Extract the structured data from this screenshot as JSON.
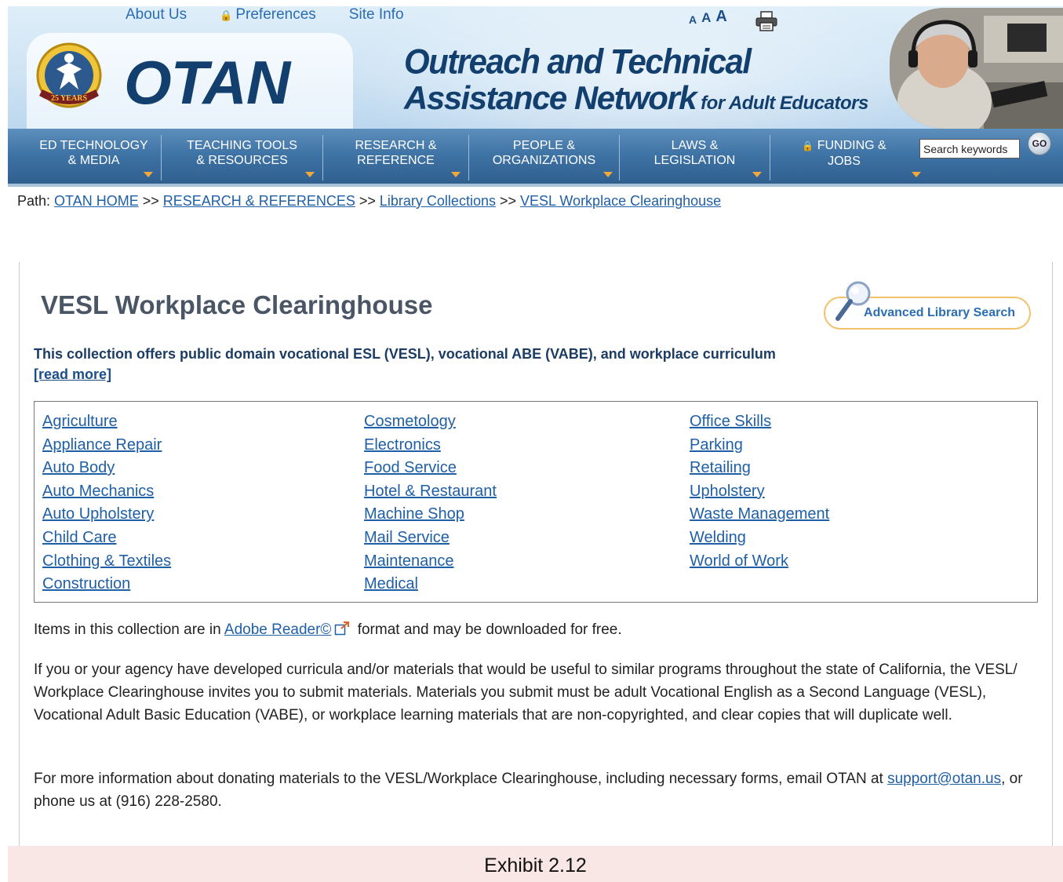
{
  "header": {
    "top_links": {
      "about": "About Us",
      "preferences": "Preferences",
      "site_info": "Site Info"
    },
    "font_sizes": [
      "A",
      "A",
      "A"
    ],
    "logo_text": "OTAN",
    "badge_text": "25 YEARS",
    "tagline_line1": "Outreach and Technical",
    "tagline_line2": "Assistance Network",
    "tagline_line3": "for Adult Educators"
  },
  "nav": {
    "items": [
      {
        "line1": "ED TECHNOLOGY",
        "line2": "& MEDIA"
      },
      {
        "line1": "TEACHING TOOLS",
        "line2": "& RESOURCES"
      },
      {
        "line1": "RESEARCH &",
        "line2": "REFERENCE"
      },
      {
        "line1": "PEOPLE &",
        "line2": "ORGANIZATIONS"
      },
      {
        "line1": "LAWS &",
        "line2": "LEGISLATION"
      },
      {
        "line1": "FUNDING &",
        "line2": "JOBS"
      }
    ],
    "search_placeholder": "Search keywords",
    "go_label": "GO"
  },
  "breadcrumb": {
    "prefix": "Path:",
    "items": [
      "OTAN HOME",
      "RESEARCH & REFERENCES",
      "Library Collections",
      "VESL Workplace Clearinghouse"
    ],
    "separator": ">>"
  },
  "main": {
    "title": "VESL Workplace Clearinghouse",
    "advanced_search_label": "Advanced Library Search",
    "summary": "This collection offers public domain vocational ESL (VESL), vocational ABE (VABE), and workplace curriculum",
    "read_more": "[read more]",
    "categories": {
      "col1": [
        "Agriculture",
        "Appliance Repair",
        "Auto Body",
        "Auto Mechanics",
        "Auto Upholstery",
        "Child Care",
        "Clothing & Textiles",
        "Construction"
      ],
      "col2": [
        "Cosmetology",
        "Electronics",
        "Food Service",
        "Hotel & Restaurant",
        "Machine Shop",
        "Mail Service",
        "Maintenance",
        "Medical"
      ],
      "col3": [
        "Office Skills",
        "Parking",
        "Retailing",
        "Upholstery",
        "Waste Management",
        "Welding",
        "World of Work"
      ]
    },
    "para1_before": "Items in this collection are in ",
    "para1_link": "Adobe Reader©",
    "para1_after": " format and may be downloaded for free.",
    "para2": "If you or your agency have developed curricula and/or materials that would be useful to similar programs throughout the state of California, the VESL/ Workplace Clearinghouse invites you to submit materials. Materials you submit must be adult Vocational English as a Second Language (VESL), Vocational Adult Basic Education (VABE), or workplace learning materials that are non-copyrighted, and clear copies that will duplicate well.",
    "para3_before": "For more information about donating materials to the VESL/Workplace Clearinghouse, including necessary forms, email OTAN at ",
    "para3_link": "support@otan.us",
    "para3_after": ", or phone us at (916) 228-2580."
  },
  "caption": "Exhibit 2.12",
  "colors": {
    "nav_bg": "#3f74a6",
    "logo_navy": "#123f6e",
    "link_blue": "#1f5fa6",
    "accent_orange": "#f2a83b",
    "caption_bg": "#f8e7e4"
  },
  "icons": [
    "lock-icon",
    "print-icon",
    "magnifier-icon",
    "external-link-icon",
    "caret-down-icon"
  ]
}
